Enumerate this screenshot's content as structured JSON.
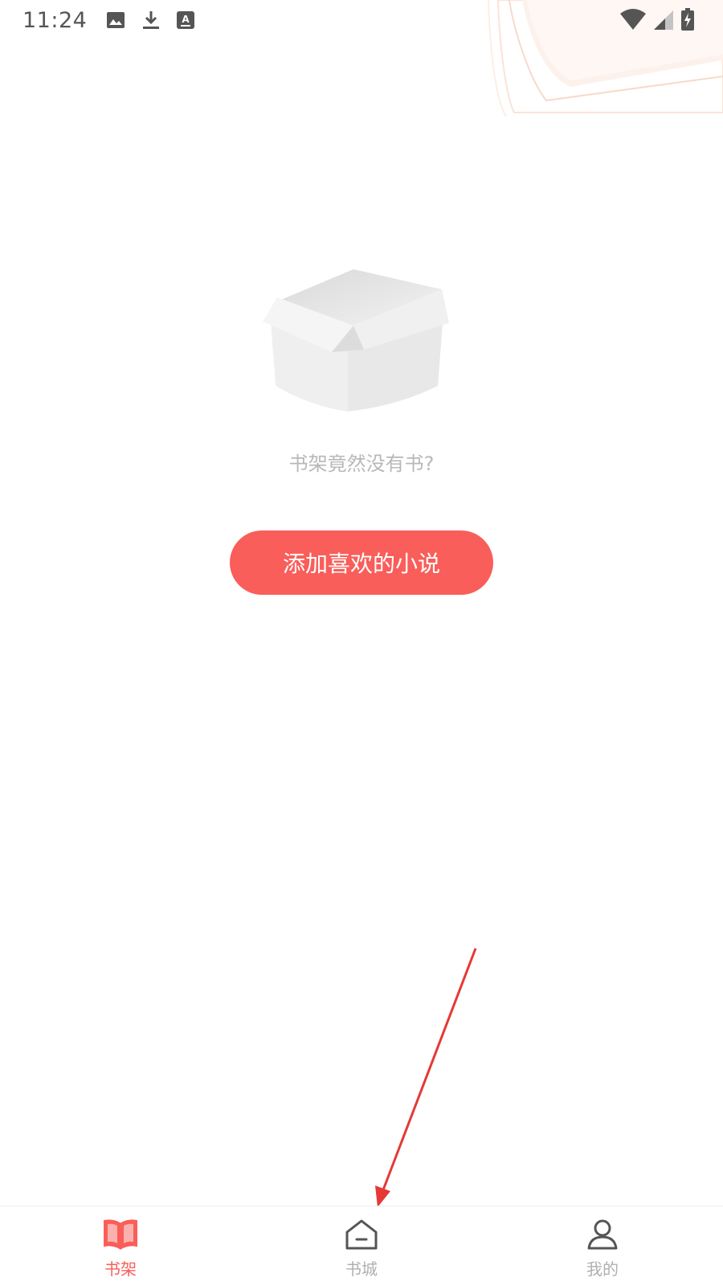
{
  "status_bar": {
    "time": "11:24",
    "left_icons": [
      "image-icon",
      "download-icon",
      "text-icon"
    ],
    "right_icons": [
      "wifi-icon",
      "signal-icon",
      "battery-charging-icon"
    ]
  },
  "empty_state": {
    "message": "书架竟然没有书?",
    "button_label": "添加喜欢的小说"
  },
  "bottom_nav": {
    "items": [
      {
        "label": "书架",
        "icon": "book-open-icon",
        "active": true
      },
      {
        "label": "书城",
        "icon": "home-icon",
        "active": false
      },
      {
        "label": "我的",
        "icon": "user-icon",
        "active": false
      }
    ]
  },
  "colors": {
    "accent": "#f95e5a",
    "inactive": "#b0b0b0",
    "annotation_arrow": "#e53935"
  }
}
